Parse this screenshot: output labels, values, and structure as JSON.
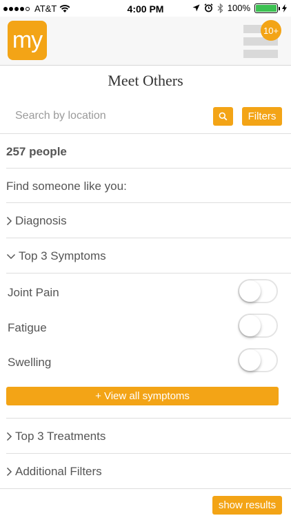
{
  "status_bar": {
    "carrier": "AT&T",
    "time": "4:00 PM",
    "battery": "100%",
    "battery_level": 1.0,
    "signal_bars": 4,
    "icons": [
      "wifi-icon",
      "location-arrow-icon",
      "alarm-icon",
      "bluetooth-icon",
      "charging-bolt-icon"
    ]
  },
  "header": {
    "logo_text": "my",
    "notification_badge": "10+",
    "menu_icon": "hamburger-menu-icon"
  },
  "page": {
    "title": "Meet Others"
  },
  "search": {
    "placeholder": "Search by location",
    "value": "",
    "search_icon": "search-icon",
    "filters_label": "Filters"
  },
  "results": {
    "count": "257 people"
  },
  "prompt": "Find someone like you:",
  "sections": {
    "diagnosis": "Diagnosis",
    "symptoms": "Top 3 Symptoms",
    "treatments": "Top 3 Treatments",
    "additional": "Additional Filters"
  },
  "symptoms": [
    {
      "label": "Joint Pain",
      "on": false
    },
    {
      "label": "Fatigue",
      "on": false
    },
    {
      "label": "Swelling",
      "on": false
    }
  ],
  "buttons": {
    "view_all": "+ View all symptoms",
    "show_results": "show results"
  },
  "colors": {
    "accent": "#f3a416",
    "header_bg": "#f7f7f7",
    "divider": "#dedede",
    "battery": "#3cc152"
  }
}
